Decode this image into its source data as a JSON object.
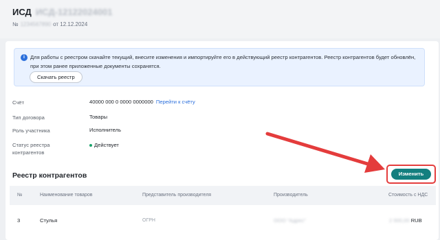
{
  "header": {
    "title_prefix": "ИСД",
    "title_id": "ИСД-12122024001",
    "number_prefix": "№",
    "number": "1234567890",
    "date_text": "от 12.12.2024"
  },
  "info": {
    "text": "Для работы с реестром скачайте текущий, внесите изменения и импортируйте его в действующий реестр контрагентов. Реестр контрагентов будет обновлён, при этом ранее приложенные документы сохранятся.",
    "download_button": "Скачать реестр"
  },
  "fields": {
    "account_label": "Счёт",
    "account_value": "40000 000 0 0000 0000000",
    "account_link": "Перейти к счёту",
    "contract_type_label": "Тип договора",
    "contract_type_value": "Товары",
    "role_label": "Роль участника",
    "role_value": "Исполнитель",
    "status_label": "Статус реестра контрагентов",
    "status_value": "Действует"
  },
  "registry": {
    "title": "Реестр контрагентов",
    "edit_button": "Изменить",
    "columns": [
      "№",
      "Наименование товаров",
      "Представитель производителя",
      "Производитель",
      "Стоимость с НДС"
    ],
    "rows": [
      {
        "num": "3",
        "name": "Стулья",
        "rep": "ОГРН",
        "maker": "ООО \"Адрес\"",
        "price": "2 500,00",
        "currency": "RUB"
      }
    ]
  },
  "colors": {
    "accent": "#137f7f",
    "link": "#2b6fdc",
    "annotation": "#e43c3c",
    "status": "#1aa36b"
  }
}
